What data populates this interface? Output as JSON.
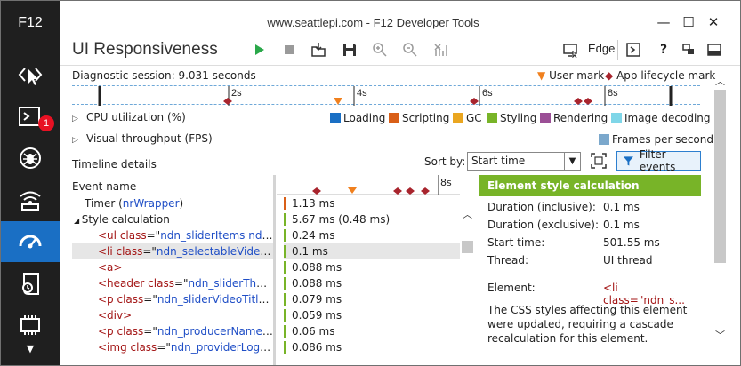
{
  "window": {
    "title": "www.seattlepi.com - F12 Developer Tools",
    "controls": {
      "minimize": "—",
      "maximize": "☐",
      "close": "✕"
    }
  },
  "sidebar": {
    "label": "F12",
    "badge": "1",
    "items": [
      {
        "icon": "dom-explorer-icon"
      },
      {
        "icon": "console-icon"
      },
      {
        "icon": "debugger-icon"
      },
      {
        "icon": "network-icon"
      },
      {
        "icon": "ui-responsiveness-icon"
      },
      {
        "icon": "profiler-icon"
      },
      {
        "icon": "memory-icon"
      }
    ]
  },
  "toolbar": {
    "tool_title": "UI Responsiveness",
    "target": "Edge",
    "icons": [
      "start-profiling-icon",
      "stop-profiling-icon",
      "import-icon",
      "export-icon",
      "zoom-in-icon",
      "zoom-out-icon",
      "reset-zoom-icon"
    ]
  },
  "session": {
    "label": "Diagnostic session: 9.031 seconds",
    "user_mark": "User mark",
    "app_mark": "App lifecycle mark",
    "ticks": [
      "2s",
      "4s",
      "6s",
      "8s"
    ]
  },
  "cpu": {
    "label": "CPU utilization (%)",
    "legend": [
      {
        "label": "Loading",
        "color": "#1a6fc4"
      },
      {
        "label": "Scripting",
        "color": "#d95f18"
      },
      {
        "label": "GC",
        "color": "#eaa620"
      },
      {
        "label": "Styling",
        "color": "#78b428"
      },
      {
        "label": "Rendering",
        "color": "#9b4f96"
      },
      {
        "label": "Image decoding",
        "color": "#7fd6e8"
      }
    ]
  },
  "throughput": {
    "label": "Visual throughput (FPS)",
    "legend": "Frames per second",
    "legend_color": "#7ba8cc"
  },
  "details": {
    "label": "Timeline details",
    "sort_label": "Sort by:",
    "sort_value": "Start time",
    "filter_label": "Filter events",
    "event_col": "Event name",
    "mini_tick": "8s"
  },
  "events": [
    {
      "indent": 1,
      "parts": [
        {
          "t": "Timer (",
          "c": "plain-black"
        },
        {
          "t": "nrWrapper",
          "c": "aval"
        },
        {
          "t": ")",
          "c": "plain-black"
        }
      ],
      "dur": "1.13 ms",
      "color": "#d95f18"
    },
    {
      "indent": 1,
      "caret": "◢",
      "parts": [
        {
          "t": "Style calculation",
          "c": "plain-black"
        }
      ],
      "dur": "5.67 ms (0.48 ms)",
      "color": "#78b428"
    },
    {
      "indent": 2,
      "parts": [
        {
          "t": "<ul ",
          "c": "tag"
        },
        {
          "t": "class",
          "c": "attr"
        },
        {
          "t": "=\"",
          "c": "plain-black"
        },
        {
          "t": "ndn_sliderItems ndn_se...",
          "c": "aval"
        }
      ],
      "dur": "0.24 ms",
      "color": "#78b428"
    },
    {
      "indent": 2,
      "sel": true,
      "parts": [
        {
          "t": "<li ",
          "c": "tag"
        },
        {
          "t": "class",
          "c": "attr"
        },
        {
          "t": "=\"",
          "c": "plain-black"
        },
        {
          "t": "ndn_selectableVideo nd...",
          "c": "aval"
        }
      ],
      "dur": "0.1 ms",
      "color": "#78b428"
    },
    {
      "indent": 2,
      "parts": [
        {
          "t": "<a>",
          "c": "tag"
        }
      ],
      "dur": "0.088 ms",
      "color": "#78b428"
    },
    {
      "indent": 2,
      "parts": [
        {
          "t": "<header ",
          "c": "tag"
        },
        {
          "t": "class",
          "c": "attr"
        },
        {
          "t": "=\"",
          "c": "plain-black"
        },
        {
          "t": "ndn_sliderThumbn...",
          "c": "aval"
        }
      ],
      "dur": "0.088 ms",
      "color": "#78b428"
    },
    {
      "indent": 2,
      "parts": [
        {
          "t": "<p ",
          "c": "tag"
        },
        {
          "t": "class",
          "c": "attr"
        },
        {
          "t": "=\"",
          "c": "plain-black"
        },
        {
          "t": "ndn_sliderVideoTitle\">",
          "c": "aval"
        }
      ],
      "dur": "0.079 ms",
      "color": "#78b428"
    },
    {
      "indent": 2,
      "parts": [
        {
          "t": "<div>",
          "c": "tag"
        }
      ],
      "dur": "0.059 ms",
      "color": "#78b428"
    },
    {
      "indent": 2,
      "parts": [
        {
          "t": "<p ",
          "c": "tag"
        },
        {
          "t": "class",
          "c": "attr"
        },
        {
          "t": "=\"",
          "c": "plain-black"
        },
        {
          "t": "ndn_producerName\">",
          "c": "aval"
        }
      ],
      "dur": "0.06 ms",
      "color": "#78b428"
    },
    {
      "indent": 2,
      "parts": [
        {
          "t": "<img ",
          "c": "tag"
        },
        {
          "t": "class",
          "c": "attr"
        },
        {
          "t": "=\"",
          "c": "plain-black"
        },
        {
          "t": "ndn_providerLogo\">",
          "c": "aval"
        }
      ],
      "dur": "0.086 ms",
      "color": "#78b428"
    }
  ],
  "detail": {
    "title": "Element style calculation",
    "rows": [
      {
        "k": "Duration (inclusive):",
        "v": "0.1 ms"
      },
      {
        "k": "Duration (exclusive):",
        "v": "0.1 ms"
      },
      {
        "k": "Start time:",
        "v": "501.55 ms"
      },
      {
        "k": "Thread:",
        "v": "UI thread"
      }
    ],
    "element_label": "Element:",
    "element_value": "<li class=\"ndn_s...",
    "description": "The CSS styles affecting this element were updated, requiring a cascade recalculation for this element."
  }
}
